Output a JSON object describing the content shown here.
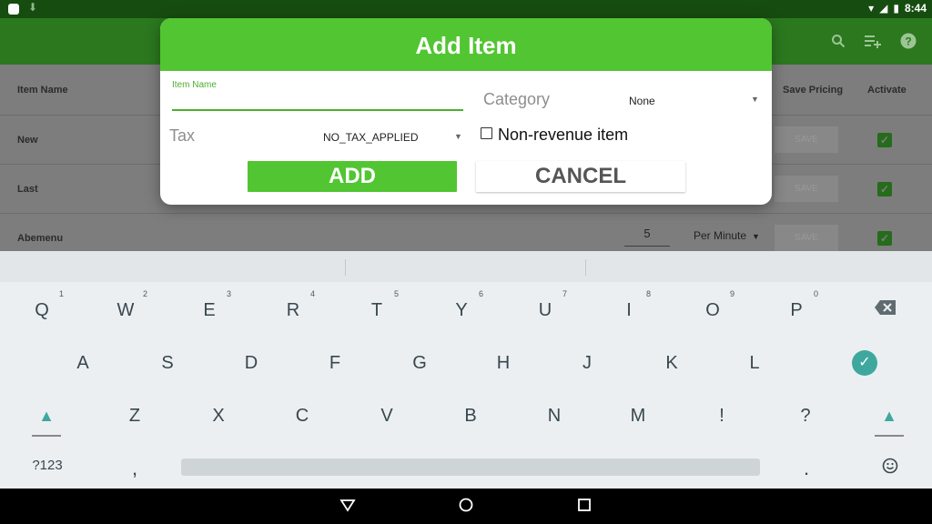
{
  "status_bar": {
    "time": "8:44"
  },
  "app_bar": {
    "icons": [
      "search-icon",
      "playlist-add-icon",
      "help-icon"
    ]
  },
  "table": {
    "headers": {
      "item_name": "Item Name",
      "save_pricing": "Save Pricing",
      "activate": "Activate"
    },
    "rows": [
      {
        "name": "New",
        "save": "SAVE",
        "active": true
      },
      {
        "name": "Last",
        "save": "SAVE",
        "active": true
      },
      {
        "name": "Abemenu",
        "quantity": "5",
        "unit": "Per Minute",
        "save": "SAVE",
        "active": true
      }
    ]
  },
  "dialog": {
    "title": "Add Item",
    "item_name_label": "Item Name",
    "item_name_value": "",
    "category_label": "Category",
    "category_value": "None",
    "tax_label": "Tax",
    "tax_value": "NO_TAX_APPLIED",
    "non_revenue_label": "Non-revenue item",
    "non_revenue_checked": false,
    "add_label": "ADD",
    "cancel_label": "CANCEL"
  },
  "keyboard": {
    "row1": [
      {
        "k": "Q",
        "h": "1"
      },
      {
        "k": "W",
        "h": "2"
      },
      {
        "k": "E",
        "h": "3"
      },
      {
        "k": "R",
        "h": "4"
      },
      {
        "k": "T",
        "h": "5"
      },
      {
        "k": "Y",
        "h": "6"
      },
      {
        "k": "U",
        "h": "7"
      },
      {
        "k": "I",
        "h": "8"
      },
      {
        "k": "O",
        "h": "9"
      },
      {
        "k": "P",
        "h": "0"
      }
    ],
    "row2": [
      "A",
      "S",
      "D",
      "F",
      "G",
      "H",
      "J",
      "K",
      "L"
    ],
    "row3": [
      "Z",
      "X",
      "C",
      "V",
      "B",
      "N",
      "M",
      "!",
      "?"
    ],
    "symbols_key": "?123",
    "comma_key": ",",
    "period_key": ".",
    "icons": [
      "backspace-icon",
      "done-check-icon",
      "shift-icon",
      "emoji-icon"
    ]
  },
  "nav_bar": {
    "icons": [
      "back-icon",
      "home-icon",
      "recents-icon"
    ]
  },
  "colors": {
    "accent": "#52c532",
    "app_bar": "#2b781f",
    "status_bar": "#174c10",
    "keyboard_accent": "#3ea89e"
  }
}
